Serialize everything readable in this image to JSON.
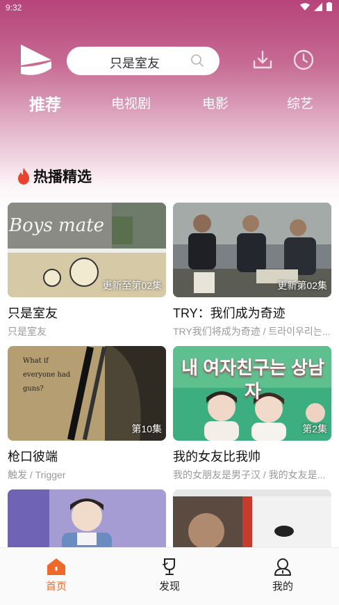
{
  "status_bar": {
    "time": "9:32"
  },
  "search": {
    "text": "只是室友"
  },
  "tabs": [
    {
      "label": "推荐",
      "active": true
    },
    {
      "label": "电视剧",
      "active": false
    },
    {
      "label": "电影",
      "active": false
    },
    {
      "label": "综艺",
      "active": false
    }
  ],
  "section": {
    "title": "热播精选"
  },
  "cards": [
    {
      "title": "只是室友",
      "subtitle": "只是室友",
      "badge": "更新至第02集",
      "thumb_text": "Boys mate"
    },
    {
      "title": "TRY：我们成为奇迹",
      "subtitle": "TRY我们将成为奇迹 / 트라이우리는...",
      "badge": "更新第02集",
      "thumb_text": ""
    },
    {
      "title": "枪口彼端",
      "subtitle": "触发 / Trigger",
      "badge": "第10集",
      "thumb_text": "What if everyone had guns?"
    },
    {
      "title": "我的女友比我帅",
      "subtitle": "我的女朋友是男子汉 / 我的女友是...",
      "badge": "第2集",
      "thumb_text": "내 여자친구는 상남자"
    },
    {
      "title": "",
      "subtitle": "",
      "badge": "",
      "thumb_text": ""
    },
    {
      "title": "",
      "subtitle": "",
      "badge": "",
      "thumb_text": ""
    }
  ],
  "bottom_nav": [
    {
      "label": "首页",
      "active": true,
      "icon": "home-icon"
    },
    {
      "label": "发现",
      "active": false,
      "icon": "trophy-icon"
    },
    {
      "label": "我的",
      "active": false,
      "icon": "user-icon"
    }
  ],
  "colors": {
    "accent": "#ee6a2c",
    "header_top": "#b6447a",
    "fire": "#e8432e"
  }
}
